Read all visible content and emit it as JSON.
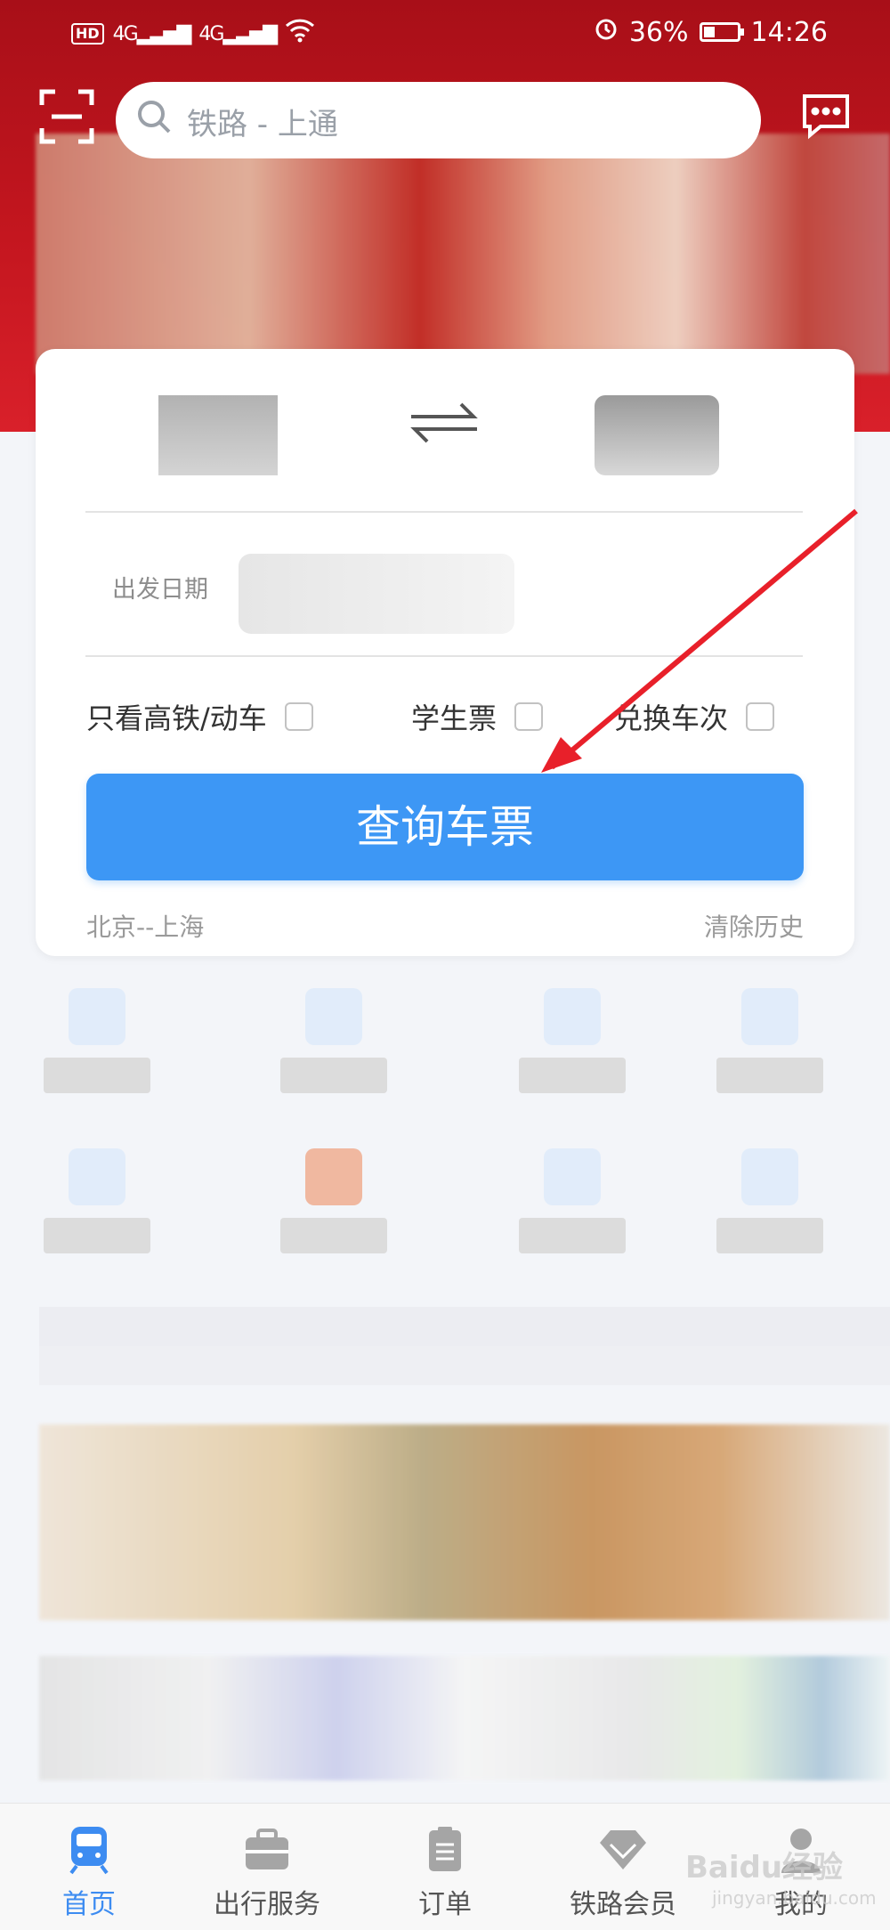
{
  "status_bar": {
    "hd": "HD",
    "net1": "4G",
    "net2": "4G",
    "battery": "36%",
    "battery_level": 0.36,
    "time": "14:26"
  },
  "header": {
    "search_placeholder": "铁路 - 上通",
    "scan_icon": "scan-icon",
    "message_icon": "message-icon"
  },
  "search_card": {
    "date_label": "出发日期",
    "options": {
      "high_speed": "只看高铁/动车",
      "student": "学生票",
      "transfer": "兑换车次"
    },
    "query_button": "查询车票",
    "history": "北京--上海",
    "clear_history": "清除历史"
  },
  "tabs": [
    {
      "label": "首页",
      "icon": "train-icon",
      "active": true
    },
    {
      "label": "出行服务",
      "icon": "briefcase-icon",
      "active": false
    },
    {
      "label": "订单",
      "icon": "order-icon",
      "active": false
    },
    {
      "label": "铁路会员",
      "icon": "diamond-icon",
      "active": false
    },
    {
      "label": "我的",
      "icon": "user-icon",
      "active": false
    }
  ],
  "watermark": {
    "main": "Baidu经验",
    "sub": "jingyan.baidu.com"
  },
  "colors": {
    "header_red": "#c4161f",
    "accent_blue": "#3d97f5",
    "annotation_red": "#e8202a"
  }
}
